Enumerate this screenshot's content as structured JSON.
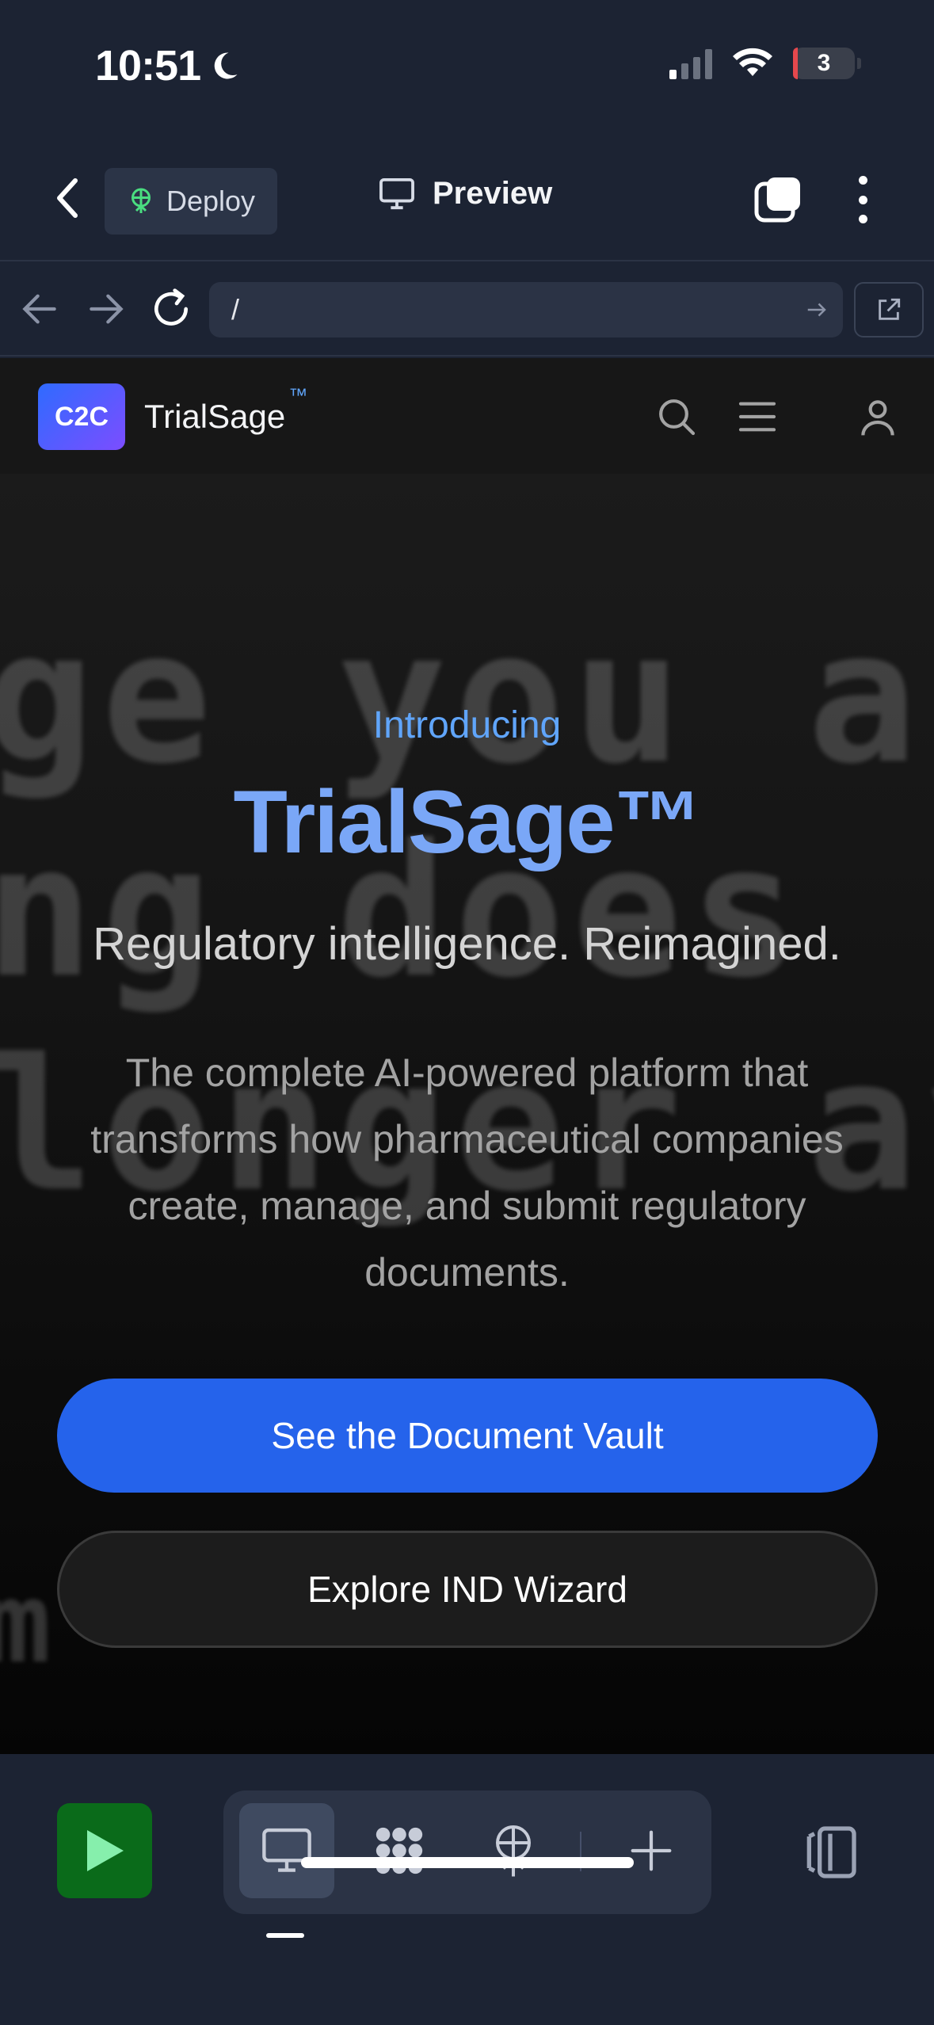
{
  "status_bar": {
    "time": "10:51",
    "battery": "3"
  },
  "toolbar": {
    "deploy_label": "Deploy",
    "preview_label": "Preview"
  },
  "url_bar": {
    "url": "/"
  },
  "site": {
    "logo_text": "C2C",
    "brand_name": "TrialSage",
    "brand_mark": "™"
  },
  "hero": {
    "background_lines": [
      "ge you ar",
      "ng does n",
      "longer av",
      "m"
    ],
    "introducing": "Introducing",
    "title": "TrialSage™",
    "subtitle": "Regulatory intelligence. Reimagined.",
    "description": "The complete AI-powered platform that transforms how pharmaceutical companies create, manage, and submit regulatory documents.",
    "primary_button": "See the Document Vault",
    "secondary_button": "Explore IND Wizard"
  },
  "icons": {
    "back": "chevron-left-icon",
    "deploy": "deploy-icon",
    "preview": "monitor-icon",
    "tabs": "tabs-icon",
    "more": "more-vertical-icon",
    "search": "search-icon",
    "menu": "menu-icon",
    "user": "user-icon",
    "run": "play-icon",
    "webview": "monitor-icon",
    "apps": "grid-blob-icon",
    "deployments": "deploy-icon",
    "add": "plus-icon",
    "panel": "panel-icon"
  },
  "colors": {
    "chrome_bg": "#1c2333",
    "accent_blue": "#2563eb",
    "title_blue": "#7aa7f7",
    "run_green": "#0a6b1a"
  }
}
